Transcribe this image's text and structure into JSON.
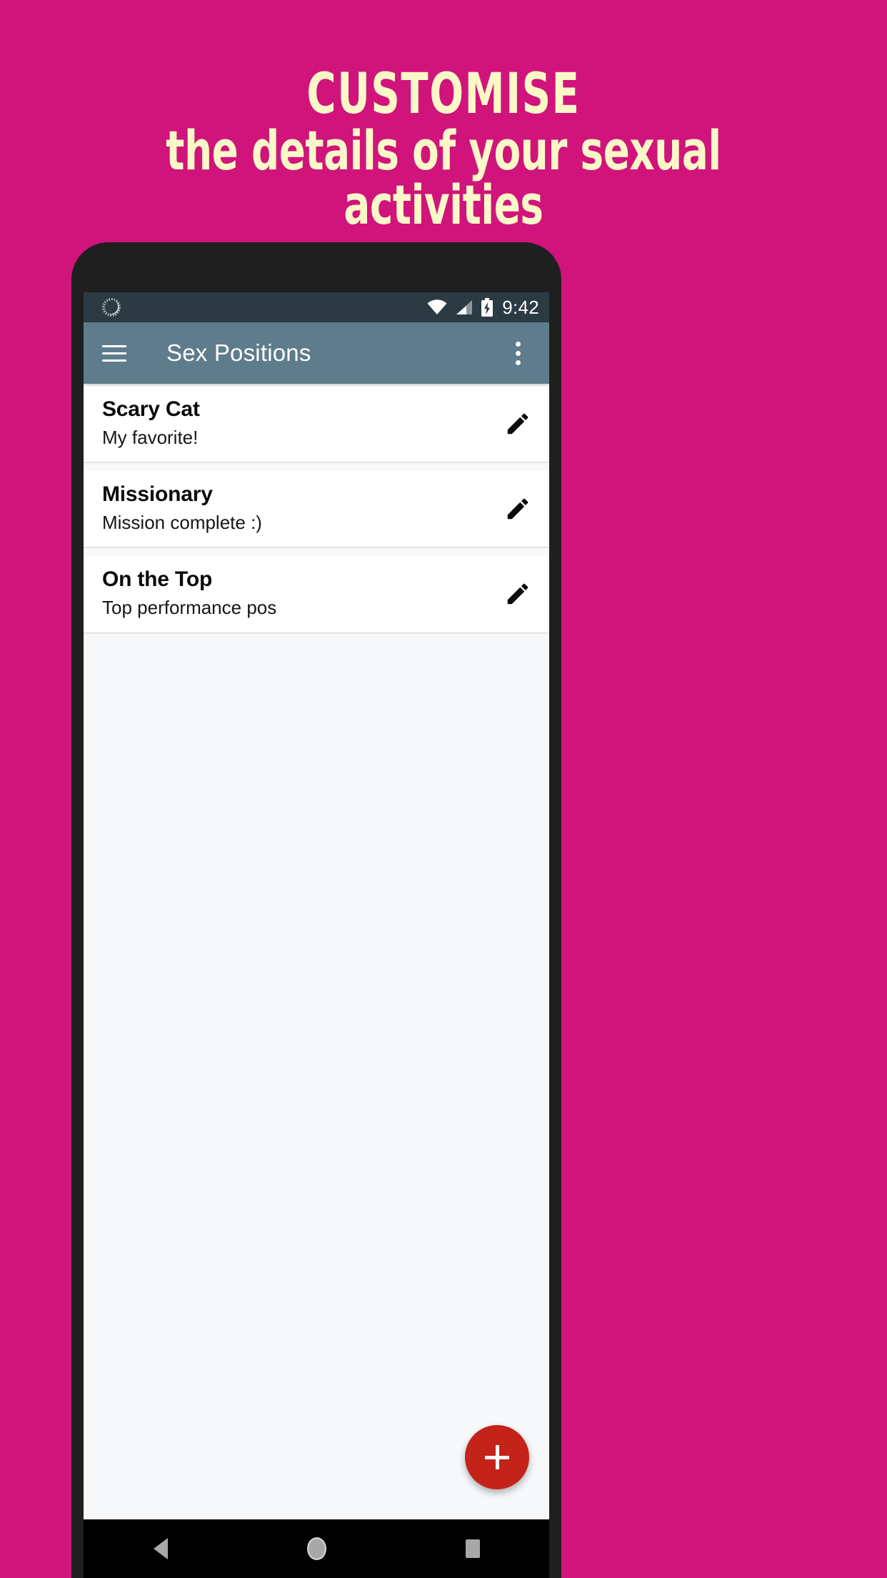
{
  "promo": {
    "background_color": "#d0147b",
    "text_color": "#fbf8c8",
    "headline_line1": "CUSTOMISE",
    "headline_line2": "the details of your sexual",
    "headline_line3": "activities"
  },
  "status_bar": {
    "sync_icon": "sync-spinner-icon",
    "wifi_icon": "wifi-icon",
    "signal_icon": "cellular-signal-icon",
    "battery_icon": "battery-charging-icon",
    "clock": "9:42",
    "background_color": "#2c3a43"
  },
  "app_bar": {
    "menu_icon": "hamburger-menu-icon",
    "title": "Sex Positions",
    "overflow_icon": "overflow-menu-icon",
    "background_color": "#5e7c8c"
  },
  "list": {
    "items": [
      {
        "title": "Scary Cat",
        "subtitle": "My favorite!",
        "edit_icon": "pencil-edit-icon"
      },
      {
        "title": "Missionary",
        "subtitle": "Mission complete :)",
        "edit_icon": "pencil-edit-icon"
      },
      {
        "title": "On the Top",
        "subtitle": "Top performance pos",
        "edit_icon": "pencil-edit-icon"
      }
    ]
  },
  "fab": {
    "icon": "plus-icon",
    "color": "#c4231a"
  },
  "nav_bar": {
    "back_icon": "back-triangle-icon",
    "home_icon": "home-circle-icon",
    "recents_icon": "recents-square-icon"
  }
}
